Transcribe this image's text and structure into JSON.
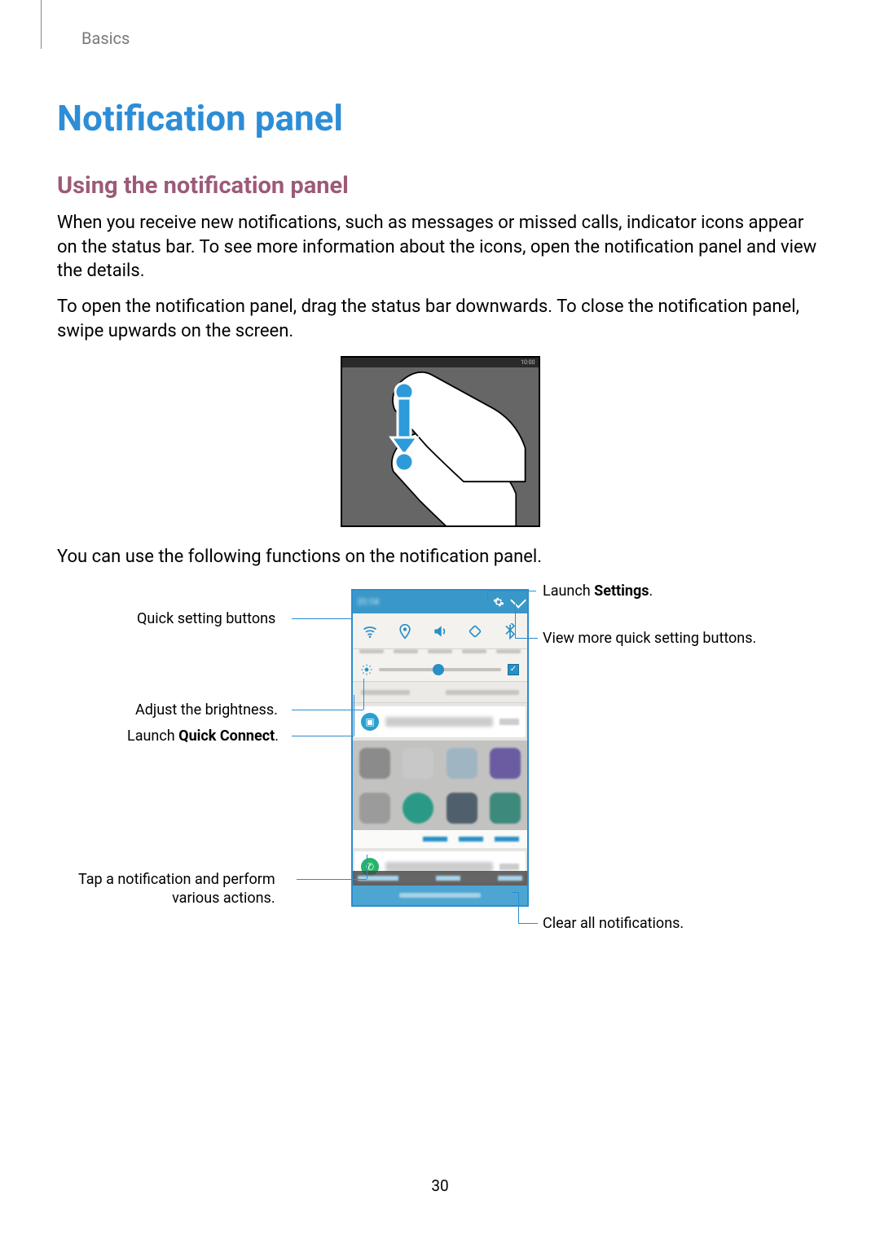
{
  "breadcrumb": "Basics",
  "title": "Notification panel",
  "subtitle": "Using the notification panel",
  "para1": "When you receive new notifications, such as messages or missed calls, indicator icons appear on the status bar. To see more information about the icons, open the notification panel and view the details.",
  "para2": "To open the notification panel, drag the status bar downwards. To close the notification panel, swipe upwards on the screen.",
  "para3": "You can use the following functions on the notification panel.",
  "fig1_status_time": "10:00",
  "callouts": {
    "settings_pre": "Launch ",
    "settings_strong": "Settings",
    "settings_post": ".",
    "quickbtns": "Quick setting buttons",
    "viewmore": "View more quick setting buttons.",
    "brightness": "Adjust the brightness.",
    "quickconnect_pre": "Launch ",
    "quickconnect_strong": "Quick Connect",
    "quickconnect_post": ".",
    "tapnotif_l1": "Tap a notification and perform",
    "tapnotif_l2": "various actions.",
    "clear": "Clear all notifications."
  },
  "page_number": "30"
}
